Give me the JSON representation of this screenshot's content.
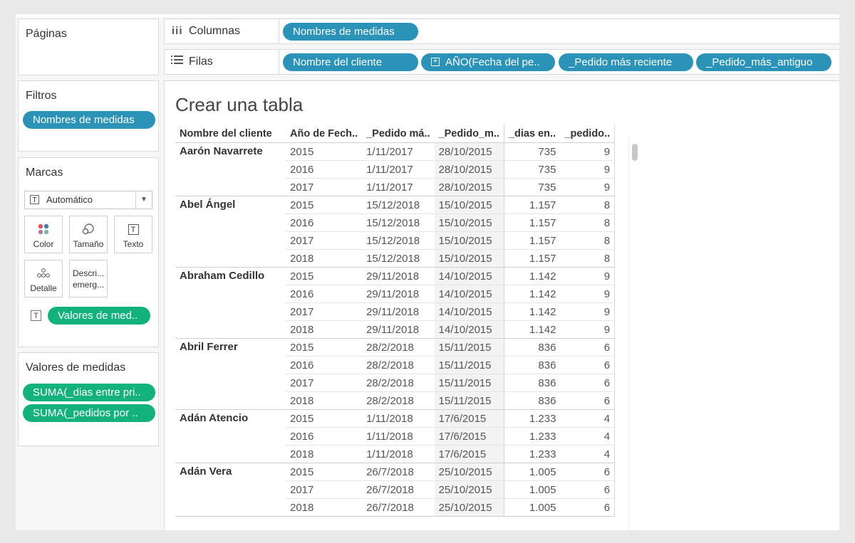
{
  "sidebar": {
    "pages_title": "Páginas",
    "filters_title": "Filtros",
    "filter_pill": "Nombres de medidas",
    "marks_title": "Marcas",
    "mark_type": "Automático",
    "mark_buttons": {
      "color": "Color",
      "size": "Tamaño",
      "text": "Texto",
      "detail": "Detalle",
      "tooltip": "Descri... emerg..."
    },
    "text_pill": "Valores de med..",
    "measure_values_title": "Valores de medidas",
    "measure_pills": [
      "SUMA(_dias entre pri..",
      "SUMA(_pedidos por .."
    ]
  },
  "shelves": {
    "columns_label": "Columnas",
    "columns_pills": [
      "Nombres de medidas"
    ],
    "rows_label": "Filas",
    "rows_pills": [
      "Nombre del cliente",
      "AÑO(Fecha del pe..",
      "_Pedido más reciente",
      "_Pedido_más_antiguo"
    ]
  },
  "view": {
    "title": "Crear una tabla",
    "headers": [
      "Nombre del cliente",
      "Año de Fech..",
      "_Pedido má..",
      "_Pedido_m..",
      "_dias en..",
      "_pedido.."
    ],
    "groups": [
      {
        "name": "Aarón Navarrete",
        "rows": [
          [
            "2015",
            "1/11/2017",
            "28/10/2015",
            "735",
            "9"
          ],
          [
            "2016",
            "1/11/2017",
            "28/10/2015",
            "735",
            "9"
          ],
          [
            "2017",
            "1/11/2017",
            "28/10/2015",
            "735",
            "9"
          ]
        ]
      },
      {
        "name": "Abel Ángel",
        "rows": [
          [
            "2015",
            "15/12/2018",
            "15/10/2015",
            "1.157",
            "8"
          ],
          [
            "2016",
            "15/12/2018",
            "15/10/2015",
            "1.157",
            "8"
          ],
          [
            "2017",
            "15/12/2018",
            "15/10/2015",
            "1.157",
            "8"
          ],
          [
            "2018",
            "15/12/2018",
            "15/10/2015",
            "1.157",
            "8"
          ]
        ]
      },
      {
        "name": "Abraham Cedillo",
        "rows": [
          [
            "2015",
            "29/11/2018",
            "14/10/2015",
            "1.142",
            "9"
          ],
          [
            "2016",
            "29/11/2018",
            "14/10/2015",
            "1.142",
            "9"
          ],
          [
            "2017",
            "29/11/2018",
            "14/10/2015",
            "1.142",
            "9"
          ],
          [
            "2018",
            "29/11/2018",
            "14/10/2015",
            "1.142",
            "9"
          ]
        ]
      },
      {
        "name": "Abril Ferrer",
        "rows": [
          [
            "2015",
            "28/2/2018",
            "15/11/2015",
            "836",
            "6"
          ],
          [
            "2016",
            "28/2/2018",
            "15/11/2015",
            "836",
            "6"
          ],
          [
            "2017",
            "28/2/2018",
            "15/11/2015",
            "836",
            "6"
          ],
          [
            "2018",
            "28/2/2018",
            "15/11/2015",
            "836",
            "6"
          ]
        ]
      },
      {
        "name": "Adán Atencio",
        "rows": [
          [
            "2015",
            "1/11/2018",
            "17/6/2015",
            "1.233",
            "4"
          ],
          [
            "2016",
            "1/11/2018",
            "17/6/2015",
            "1.233",
            "4"
          ],
          [
            "2018",
            "1/11/2018",
            "17/6/2015",
            "1.233",
            "4"
          ]
        ]
      },
      {
        "name": "Adán Vera",
        "rows": [
          [
            "2015",
            "26/7/2018",
            "25/10/2015",
            "1.005",
            "6"
          ],
          [
            "2017",
            "26/7/2018",
            "25/10/2015",
            "1.005",
            "6"
          ],
          [
            "2018",
            "26/7/2018",
            "25/10/2015",
            "1.005",
            "6"
          ]
        ]
      }
    ]
  },
  "colors": {
    "dimension_pill": "#2a93b7",
    "measure_pill": "#13b27c"
  }
}
